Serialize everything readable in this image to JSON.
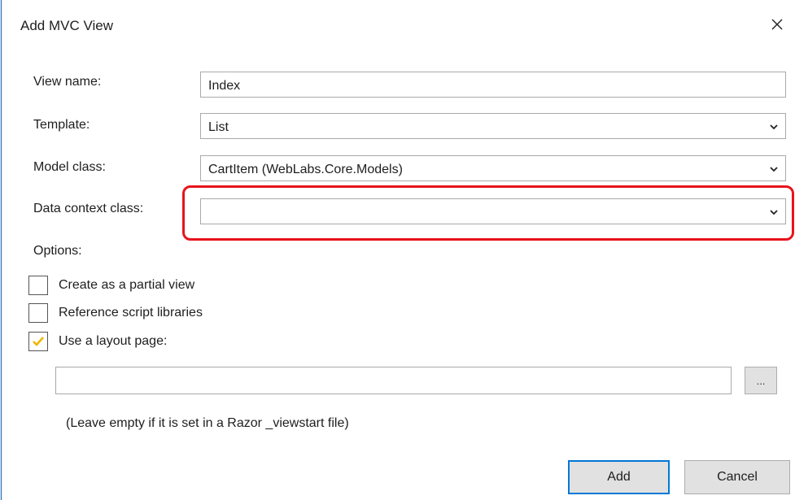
{
  "dialog": {
    "title": "Add MVC View",
    "close_glyph": "×"
  },
  "form": {
    "view_name": {
      "label": "View name:",
      "value": "Index"
    },
    "template": {
      "label": "Template:",
      "value": "List"
    },
    "model_class": {
      "label": "Model class:",
      "value": "CartItem (WebLabs.Core.Models)"
    },
    "data_context_class": {
      "label": "Data context class:",
      "value": ""
    }
  },
  "options": {
    "heading": "Options:",
    "partial_view": {
      "label": "Create as a partial view",
      "checked": false
    },
    "script_libraries": {
      "label": "Reference script libraries",
      "checked": false
    },
    "layout_page": {
      "label": "Use a layout page:",
      "checked": true
    }
  },
  "layout": {
    "path_value": "",
    "browse_label": "...",
    "hint": "(Leave empty if it is set in a Razor _viewstart file)"
  },
  "buttons": {
    "add": "Add",
    "cancel": "Cancel"
  },
  "colors": {
    "highlight": "#e8131c",
    "checkbox_fill": "#f5c242",
    "accent": "#0078d7"
  },
  "icons": {
    "close": "close-icon",
    "dropdown": "chevron-down-icon",
    "check": "checkmark-icon"
  }
}
